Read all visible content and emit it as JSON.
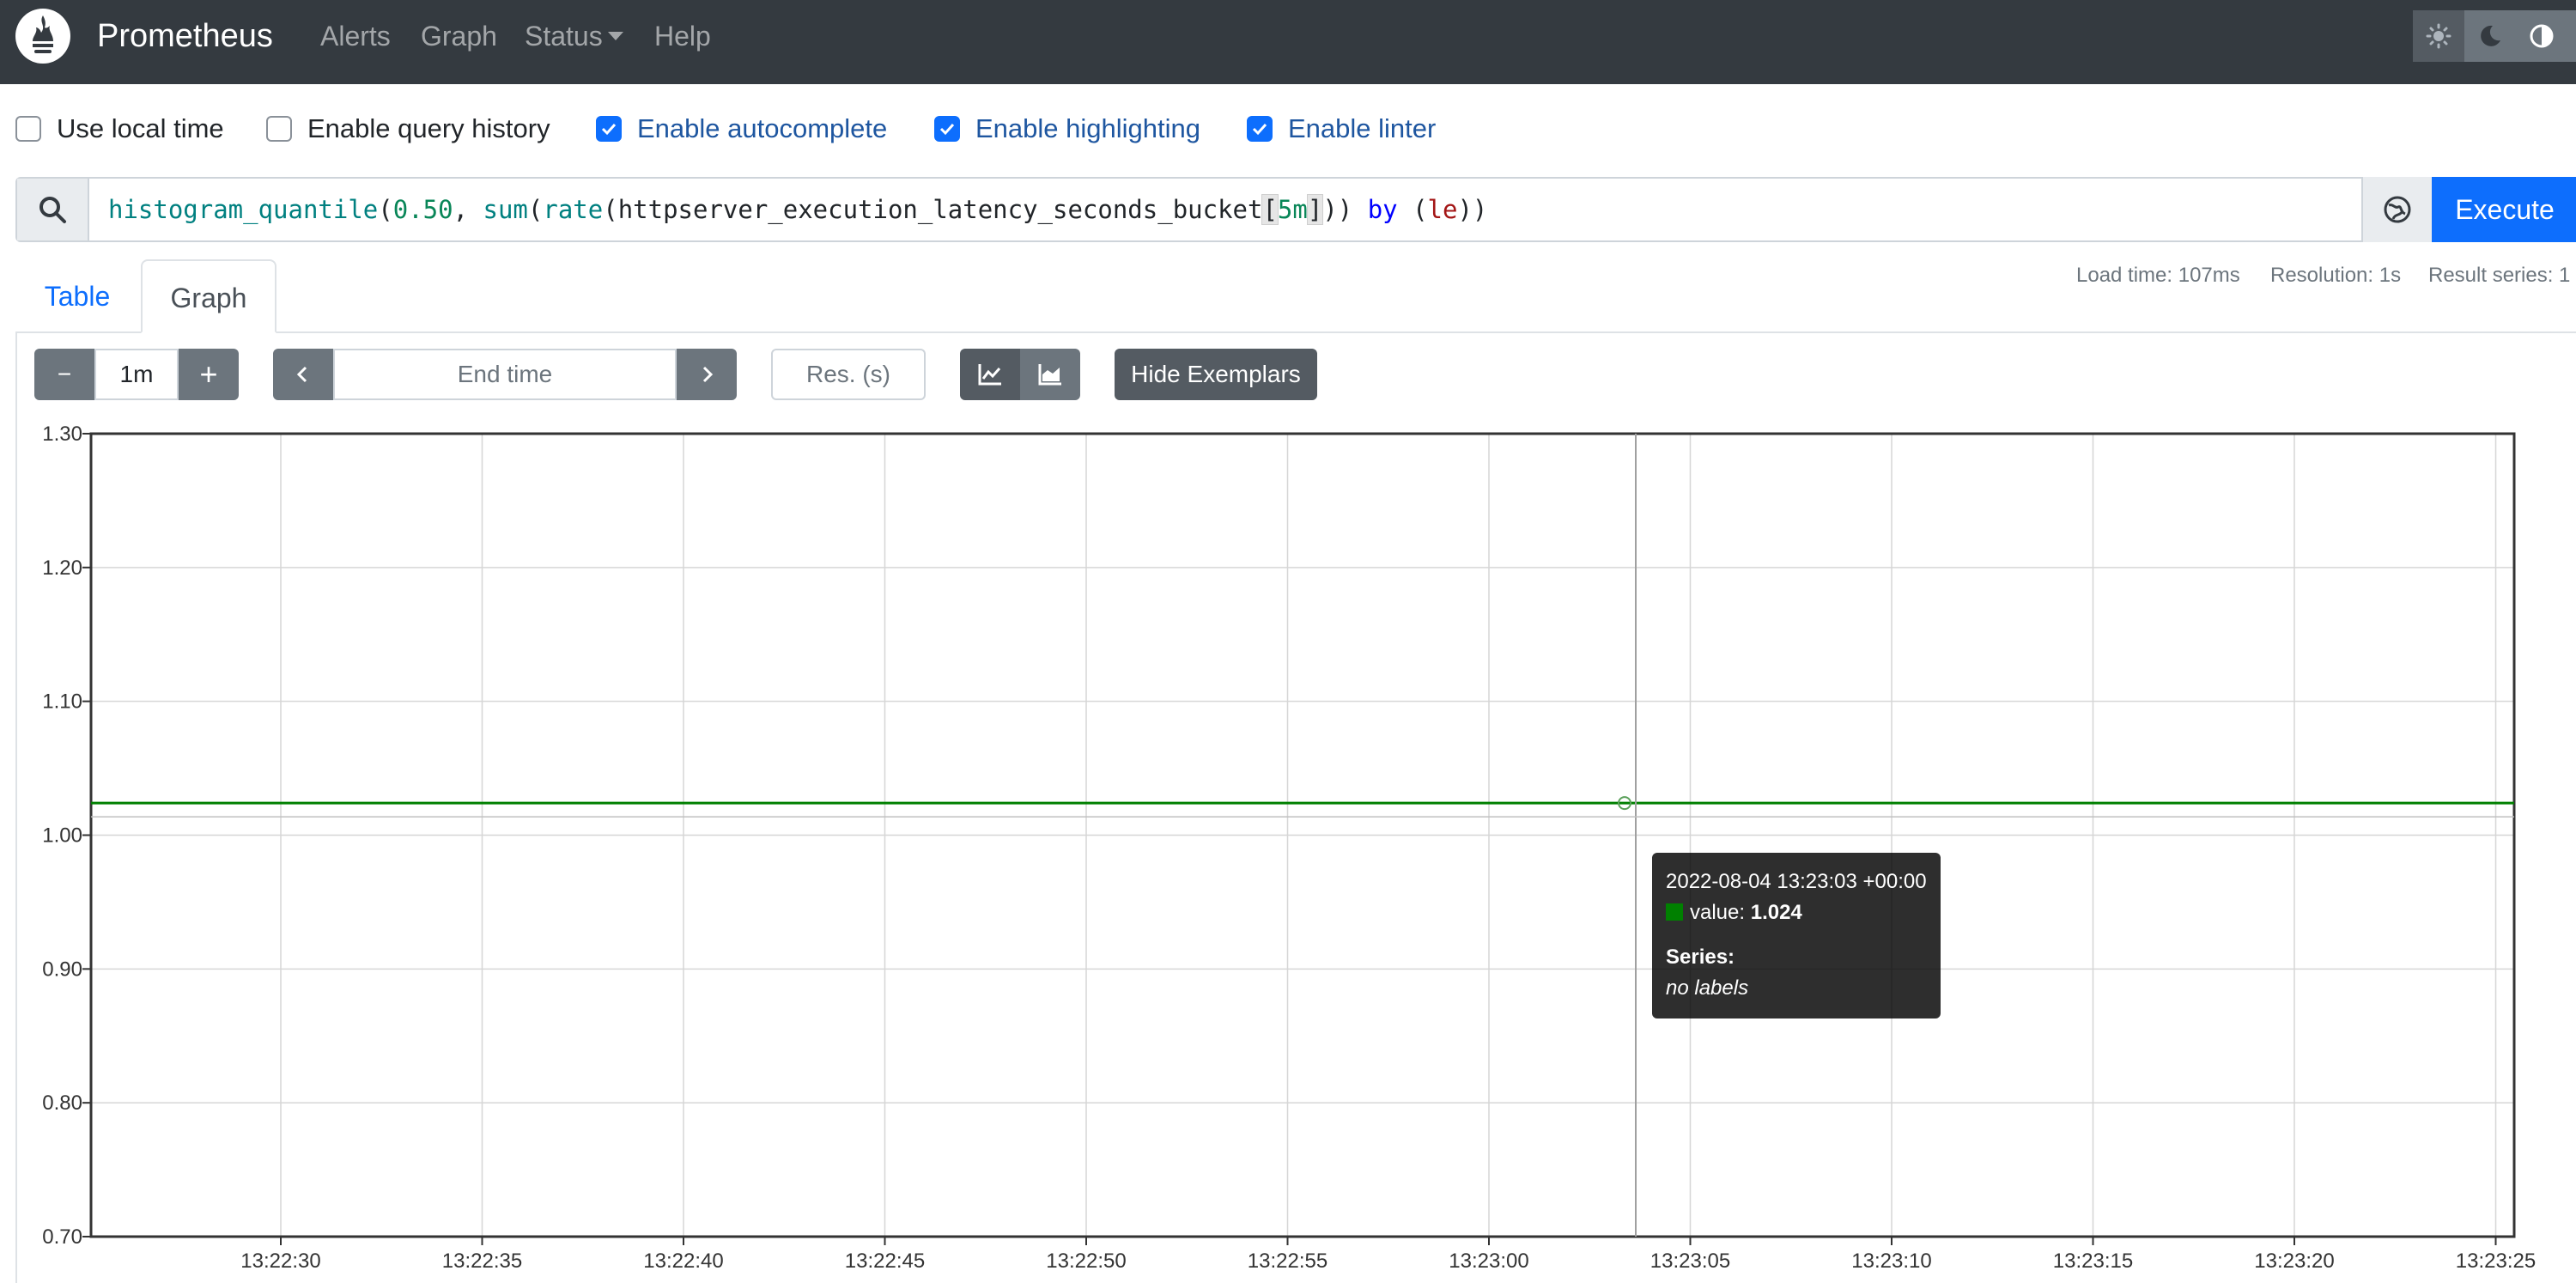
{
  "navbar": {
    "brand": "Prometheus",
    "links": [
      "Alerts",
      "Graph",
      "Status",
      "Help"
    ],
    "theme_buttons": [
      "light-theme",
      "dark-theme",
      "browser-default-theme"
    ]
  },
  "options": [
    {
      "label": "Use local time",
      "checked": false
    },
    {
      "label": "Enable query history",
      "checked": false
    },
    {
      "label": "Enable autocomplete",
      "checked": true
    },
    {
      "label": "Enable highlighting",
      "checked": true
    },
    {
      "label": "Enable linter",
      "checked": true
    }
  ],
  "query": {
    "expression": "histogram_quantile(0.50, sum(rate(httpserver_execution_latency_seconds_bucket[5m])) by (le))",
    "execute_label": "Execute"
  },
  "tabs": {
    "table": "Table",
    "graph": "Graph"
  },
  "stats": {
    "load_time": "Load time: 107ms",
    "resolution": "Resolution: 1s",
    "result_series": "Result series: 1"
  },
  "controls": {
    "range_minus": "−",
    "range_value": "1m",
    "range_plus": "+",
    "end_time_placeholder": "End time",
    "resolution_placeholder": "Res. (s)",
    "hide_exemplars": "Hide Exemplars"
  },
  "chart_data": {
    "type": "line",
    "ylim": [
      0.7,
      1.3
    ],
    "y_ticks": [
      "0.70",
      "0.80",
      "0.90",
      "1.00",
      "1.10",
      "1.20",
      "1.30"
    ],
    "x_ticks": [
      "13:22:30",
      "13:22:35",
      "13:22:40",
      "13:22:45",
      "13:22:50",
      "13:22:55",
      "13:23:00",
      "13:23:05",
      "13:23:10",
      "13:23:15",
      "13:23:20",
      "13:23:25"
    ],
    "series": [
      {
        "values": [
          1.024,
          1.024
        ],
        "color": "#008000"
      }
    ],
    "hover": {
      "time": "13:23:03",
      "value": 1.024
    },
    "grid": true
  },
  "tooltip": {
    "timestamp": "2022-08-04 13:23:03 +00:00",
    "value_label": "value:",
    "value": "1.024",
    "series_label": "Series:",
    "series_value": "no labels"
  }
}
